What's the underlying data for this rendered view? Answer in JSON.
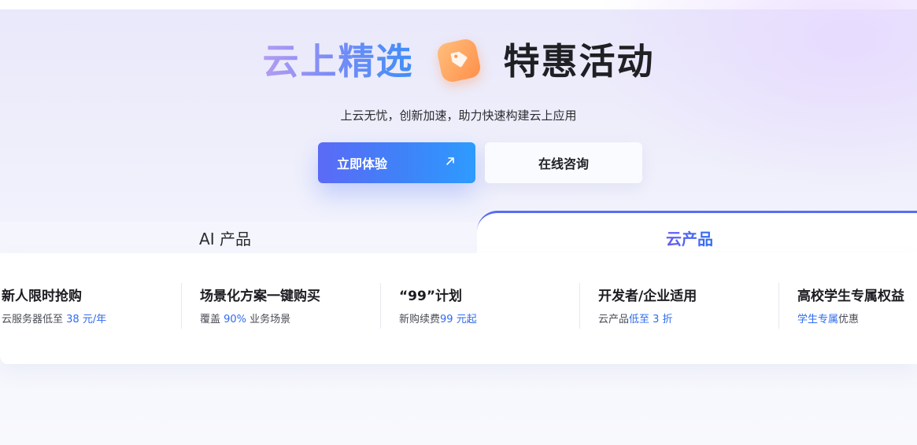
{
  "hero": {
    "title_gradient": "云上精选",
    "title_dark": "特惠活动",
    "subtitle": "上云无忧，创新加速，助力快速构建云上应用",
    "icon": "price-tag-icon"
  },
  "buttons": {
    "primary_label": "立即体验",
    "primary_icon": "arrow-up-right-icon",
    "secondary_label": "在线咨询"
  },
  "tabs": [
    {
      "label": "AI 产品",
      "active": false
    },
    {
      "label": "云产品",
      "active": true
    }
  ],
  "cards": [
    {
      "title": "新人限时抢购",
      "desc_pre": "云服务器低至 ",
      "desc_hl": "38 元/年",
      "desc_post": ""
    },
    {
      "title": "场景化方案一键购买",
      "desc_pre": "覆盖 ",
      "desc_hl": "90%",
      "desc_post": " 业务场景"
    },
    {
      "title": "“99”计划",
      "desc_pre": "新购续费",
      "desc_hl": "99 元起",
      "desc_post": ""
    },
    {
      "title": "开发者/企业适用",
      "desc_pre": "云产品",
      "desc_hl": "低至 3 折",
      "desc_post": ""
    },
    {
      "title": "高校学生专属权益",
      "desc_pre": "",
      "desc_hl": "学生专属",
      "desc_post": "优惠"
    }
  ],
  "colors": {
    "accent": "#2f6bf0",
    "primary_button_start": "#5b6af6",
    "primary_button_end": "#2e9bff",
    "tag_orange": "#ff8f4a"
  }
}
